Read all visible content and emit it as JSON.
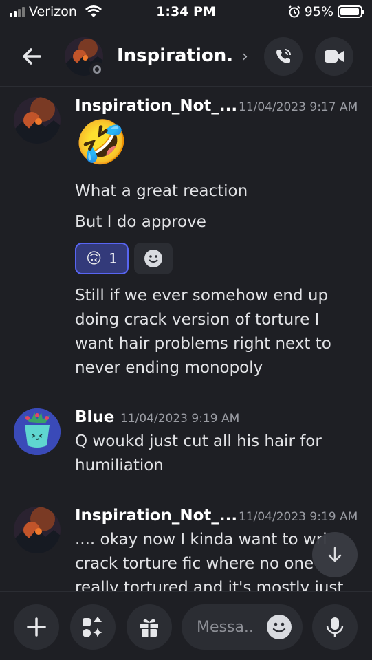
{
  "status_bar": {
    "carrier": "Verizon",
    "time": "1:34 PM",
    "battery": "95%",
    "battery_level": 0.95
  },
  "header": {
    "title": "Inspiration...",
    "chevron": "›",
    "call_icon": "phone-icon",
    "video_icon": "video-camera-icon"
  },
  "messages": [
    {
      "author": "Inspiration_Not_...",
      "timestamp": "11/04/2023 9:17 AM",
      "emoji": "🤣",
      "lines": [
        "What a great reaction",
        "But I do approve"
      ],
      "reaction": {
        "emoji": "🙃",
        "count": "1"
      },
      "body": [
        "Still if we ever somehow end up",
        "doing crack version of torture I",
        "want hair problems right next to",
        "never ending monopoly"
      ]
    },
    {
      "author": "Blue",
      "timestamp": "11/04/2023 9:19 AM",
      "body": [
        "Q woukd just cut all his hair for",
        "humiliation"
      ]
    },
    {
      "author": "Inspiration_Not_...",
      "timestamp": "11/04/2023 9:19 AM",
      "body": [
        ".... okay now I kinda want to wri",
        "crack torture fic where no one",
        "really tortured and it's mostly just"
      ]
    }
  ],
  "composer": {
    "placeholder": "Messa.."
  },
  "colors": {
    "background": "#1e1f24",
    "button": "#2b2d33",
    "reaction_active_bg": "#333a7a",
    "reaction_active_border": "#5865f2",
    "timestamp": "#9a9ca3"
  }
}
